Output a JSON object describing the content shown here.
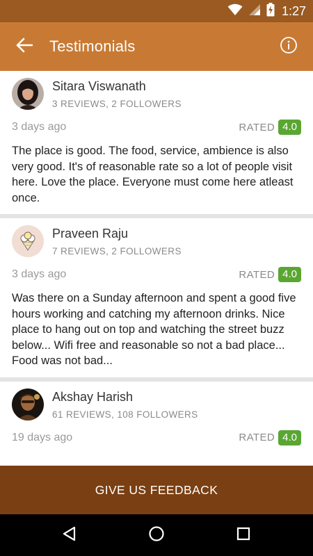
{
  "status_bar": {
    "time": "1:27",
    "icons": [
      "wifi-icon",
      "signal-icon",
      "battery-charging-icon"
    ]
  },
  "app_bar": {
    "title": "Testimonials",
    "back_icon": "arrow-left-icon",
    "info_icon": "info-icon"
  },
  "reviews": [
    {
      "name": "Sitara Viswanath",
      "stats": "3 REVIEWS, 2 FOLLOWERS",
      "date": "3 days ago",
      "rated_label": "RATED",
      "rating": "4.0",
      "text": "The place is good. The food, service, ambience is also very good. It's of reasonable rate so a lot of people visit here. Love the place. Everyone must come here atleast once."
    },
    {
      "name": "Praveen Raju",
      "stats": "7 REVIEWS, 2 FOLLOWERS",
      "date": "3 days ago",
      "rated_label": "RATED",
      "rating": "4.0",
      "text": "Was there on a Sunday afternoon and spent a good five hours working and catching my afternoon drinks. Nice place to hang out on top and watching the street buzz below... Wifi free and reasonable so not a bad place... Food was not bad..."
    },
    {
      "name": "Akshay Harish",
      "stats": "61 REVIEWS, 108 FOLLOWERS",
      "date": "19 days ago",
      "rated_label": "RATED",
      "rating": "4.0",
      "text": ""
    }
  ],
  "feedback_button": {
    "label": "GIVE US FEEDBACK"
  },
  "nav_bar": {
    "icons": [
      "back-triangle-icon",
      "home-circle-icon",
      "recents-square-icon"
    ]
  },
  "colors": {
    "status_bar": "#9a5a21",
    "app_bar": "#c87a34",
    "feedback_bar": "#7a3f12",
    "rating_badge": "#5aa632"
  }
}
